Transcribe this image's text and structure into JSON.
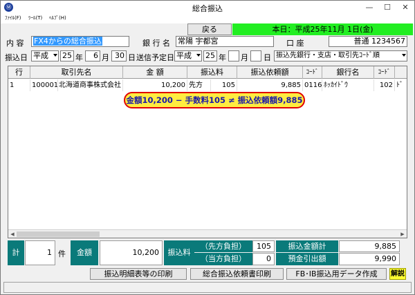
{
  "window": {
    "title": "総合振込",
    "app_icon": "Ⓜ",
    "minimize": "—",
    "maximize": "☐",
    "close": "✕"
  },
  "menu": [
    "ﾌｧｲﾙ(F)",
    "ﾂｰﾙ(T)",
    "ﾍﾙﾌﾟ(H)"
  ],
  "toolbar": {
    "back_label": "戻る",
    "today": "本日：平成25年11月 1日(金)"
  },
  "form": {
    "naiyou_label": "内 容",
    "naiyou_value": "FX4からの総合振込",
    "bank_label": "銀 行 名",
    "bank_value": "常陽 宇都宮",
    "account_label": "口 座",
    "account_value": "普通 1234567",
    "transfer_date_label": "振込日",
    "era": "平成",
    "year": "25",
    "year_suffix": "年",
    "month": "6",
    "month_suffix": "月",
    "day": "30",
    "day_suffix": "日",
    "send_date_label": "送信予定日",
    "send_era": "平成",
    "send_year": "25",
    "send_year_suffix": "年",
    "send_month": "",
    "send_month_suffix": "月",
    "send_day": "",
    "send_day_suffix": "日",
    "sort_value": "振込先銀行・支店・取引先ｺｰﾄﾞ順"
  },
  "table": {
    "headers": [
      "行",
      "取引先名",
      "金 額",
      "振込料",
      "振込依頼額",
      "ｺｰﾄﾞ",
      "銀行名",
      "ｺｰﾄﾞ"
    ],
    "row": [
      "1",
      "100001",
      "北海道商事株式会社",
      "10,200",
      "先方",
      "105",
      "9,885",
      "0116",
      "ﾎｯｶｲﾄﾞｳ",
      "102",
      "ﾄﾞ"
    ]
  },
  "callout": "金額10,200 − 手数料105 ≠ 振込依頼額9,885",
  "summary": {
    "total_label": "計",
    "count": "1",
    "count_unit": "件",
    "amount_label": "金額",
    "amount": "10,200",
    "fee_label": "振込料",
    "fee_sender_label": "（先方負担）",
    "fee_sender": "105",
    "fee_self_label": "（当方負担）",
    "fee_self": "0",
    "transfer_total_label": "振込金額計",
    "transfer_total": "9,885",
    "withdrawal_label": "預金引出額",
    "withdrawal": "9,990"
  },
  "buttons": {
    "print_list": "振込明細表等の印刷",
    "print_request": "総合振込依頼書印刷",
    "fb_data": "FB･IB振込用データ作成",
    "help": "解説"
  }
}
